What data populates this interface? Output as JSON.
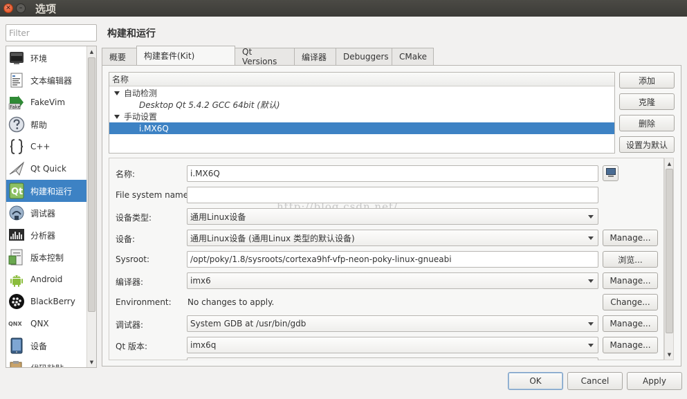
{
  "window": {
    "title": "选项",
    "close_glyph": "✕",
    "min_glyph": "–"
  },
  "filter": {
    "placeholder": "Filter"
  },
  "sidebar": {
    "items": [
      {
        "label": "环境",
        "icon": "monitor-icon"
      },
      {
        "label": "文本编辑器",
        "icon": "text-editor-icon"
      },
      {
        "label": "FakeVim",
        "icon": "fakevim-icon"
      },
      {
        "label": "帮助",
        "icon": "help-icon"
      },
      {
        "label": "C++",
        "icon": "cpp-braces-icon"
      },
      {
        "label": "Qt Quick",
        "icon": "qt-quick-icon"
      },
      {
        "label": "构建和运行",
        "icon": "build-run-icon",
        "selected": true
      },
      {
        "label": "调试器",
        "icon": "debugger-icon"
      },
      {
        "label": "分析器",
        "icon": "analyzer-icon"
      },
      {
        "label": "版本控制",
        "icon": "version-control-icon"
      },
      {
        "label": "Android",
        "icon": "android-icon"
      },
      {
        "label": "BlackBerry",
        "icon": "blackberry-icon"
      },
      {
        "label": "QNX",
        "icon": "qnx-icon"
      },
      {
        "label": "设备",
        "icon": "device-icon"
      },
      {
        "label": "代码粘贴",
        "icon": "code-paste-icon"
      }
    ]
  },
  "page": {
    "title": "构建和运行"
  },
  "tabs": [
    {
      "label": "概要"
    },
    {
      "label": "构建套件(Kit)",
      "active": true
    },
    {
      "label": "Qt Versions"
    },
    {
      "label": "编译器"
    },
    {
      "label": "Debuggers"
    },
    {
      "label": "CMake"
    }
  ],
  "tree": {
    "header": "名称",
    "rows": [
      {
        "label": "自动检测"
      },
      {
        "label": "Desktop Qt 5.4.2 GCC 64bit (默认)"
      },
      {
        "label": "手动设置"
      },
      {
        "label": "i.MX6Q",
        "selected": true
      }
    ]
  },
  "kit_buttons": {
    "add": "添加",
    "clone": "克隆",
    "delete": "删除",
    "make_default": "设置为默认"
  },
  "form": {
    "name": {
      "label": "名称:",
      "value": "i.MX6Q"
    },
    "filesystem": {
      "label": "File system name:",
      "value": ""
    },
    "device_type": {
      "label": "设备类型:",
      "value": "通用Linux设备"
    },
    "device": {
      "label": "设备:",
      "value": "通用Linux设备 (通用Linux 类型的默认设备)",
      "button": "Manage..."
    },
    "sysroot": {
      "label": "Sysroot:",
      "value": "/opt/poky/1.8/sysroots/cortexa9hf-vfp-neon-poky-linux-gnueabi",
      "button": "浏览..."
    },
    "compiler": {
      "label": "编译器:",
      "value": "imx6",
      "button": "Manage..."
    },
    "environment": {
      "label": "Environment:",
      "value": "No changes to apply.",
      "button": "Change..."
    },
    "debugger": {
      "label": "调试器:",
      "value": "System GDB at /usr/bin/gdb",
      "button": "Manage..."
    },
    "qt_version": {
      "label": "Qt 版本:",
      "value": "imx6q",
      "button": "Manage..."
    }
  },
  "watermark": "http://blog.csdn.net/",
  "dialog_buttons": {
    "ok": "OK",
    "cancel": "Cancel",
    "apply": "Apply"
  },
  "colors": {
    "selection": "#3d82c4",
    "titlebar": "#3c3b37",
    "close_button": "#df4a16"
  }
}
